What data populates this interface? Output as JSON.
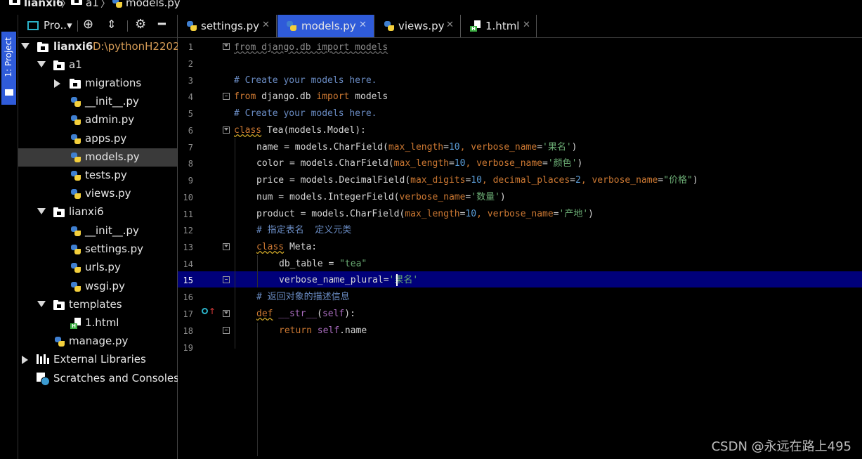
{
  "breadcrumb": {
    "items": [
      "lianxi6",
      "a1",
      "models.py"
    ],
    "separator": "〉"
  },
  "side_strip": {
    "tab_label": "1: Project"
  },
  "project_panel": {
    "view_selector": "Pro..▾",
    "tree": [
      {
        "label": "lianxi6",
        "path": "D:\\pythonH2202",
        "type": "folder",
        "expanded": true
      },
      {
        "label": "a1",
        "type": "folder",
        "expanded": true
      },
      {
        "label": "migrations",
        "type": "folder",
        "expanded": false
      },
      {
        "label": "__init__.py",
        "type": "python"
      },
      {
        "label": "admin.py",
        "type": "python"
      },
      {
        "label": "apps.py",
        "type": "python"
      },
      {
        "label": "models.py",
        "type": "python",
        "selected": true
      },
      {
        "label": "tests.py",
        "type": "python"
      },
      {
        "label": "views.py",
        "type": "python"
      },
      {
        "label": "lianxi6",
        "type": "folder",
        "expanded": true
      },
      {
        "label": "__init__.py",
        "type": "python"
      },
      {
        "label": "settings.py",
        "type": "python"
      },
      {
        "label": "urls.py",
        "type": "python"
      },
      {
        "label": "wsgi.py",
        "type": "python"
      },
      {
        "label": "templates",
        "type": "folder",
        "expanded": true
      },
      {
        "label": "1.html",
        "type": "html"
      },
      {
        "label": "manage.py",
        "type": "python"
      },
      {
        "label": "External Libraries",
        "type": "library",
        "expanded": false
      },
      {
        "label": "Scratches and Consoles",
        "type": "scratch"
      }
    ]
  },
  "tabs": [
    {
      "label": "settings.py",
      "icon": "python-file-icon",
      "active": false
    },
    {
      "label": "models.py",
      "icon": "python-file-icon",
      "active": true
    },
    {
      "label": "views.py",
      "icon": "python-file-icon",
      "active": false
    },
    {
      "label": "1.html",
      "icon": "html-file-icon",
      "active": false
    }
  ],
  "editor": {
    "current_line": 15,
    "line_numbers": [
      "1",
      "2",
      "3",
      "4",
      "5",
      "6",
      "7",
      "8",
      "9",
      "10",
      "11",
      "12",
      "13",
      "14",
      "15",
      "16",
      "17",
      "18",
      "19"
    ],
    "code": {
      "l1": {
        "a": "from django.db import models"
      },
      "l3": {
        "a": "# Create your models here."
      },
      "l4": {
        "a": "from",
        "b": " django.db ",
        "c": "import",
        "d": " models"
      },
      "l5": {
        "a": "# Create your models here."
      },
      "l6": {
        "a": "class",
        "b": " Tea(models.Model):"
      },
      "l7": {
        "a": "name = models.CharField(",
        "b": "max_length",
        "c": "=",
        "d": "10",
        "e": ", ",
        "f": "verbose_name",
        "g": "=",
        "h": "'果名'",
        "i": ")"
      },
      "l8": {
        "a": "color = models.CharField(",
        "b": "max_length",
        "c": "=",
        "d": "10",
        "e": ", ",
        "f": "verbose_name",
        "g": "=",
        "h": "'颜色'",
        "i": ")"
      },
      "l9": {
        "a": "price = models.DecimalField(",
        "b": "max_digits",
        "c": "=",
        "d": "10",
        "e": ", ",
        "f": "decimal_places",
        "g": "=",
        "h": "2",
        "i": ", ",
        "j": "verbose_name",
        "k": "=",
        "l": "\"价格\"",
        "m": ")"
      },
      "l10": {
        "a": "num = models.IntegerField(",
        "b": "verbose_name",
        "c": "=",
        "d": "'数量'",
        "e": ")"
      },
      "l11": {
        "a": "product = models.CharField(",
        "b": "max_length",
        "c": "=",
        "d": "10",
        "e": ", ",
        "f": "verbose_name",
        "g": "=",
        "h": "'产地'",
        "i": ")"
      },
      "l12": {
        "a": "# 指定表名  定义元类"
      },
      "l13": {
        "a": "class",
        "b": " Meta:"
      },
      "l14": {
        "a": "db_table = ",
        "b": "\"tea\""
      },
      "l15": {
        "a": "verbose_name_plural=",
        "b": "'果名'"
      },
      "l16": {
        "a": "# 返回对象的描述信息"
      },
      "l17": {
        "a": "def",
        "b": " __str__",
        "c": "(",
        "d": "self",
        "e": "):"
      },
      "l18": {
        "a": "return ",
        "b": "self",
        "c": ".name"
      }
    }
  },
  "watermark": "CSDN @永远在路上495"
}
